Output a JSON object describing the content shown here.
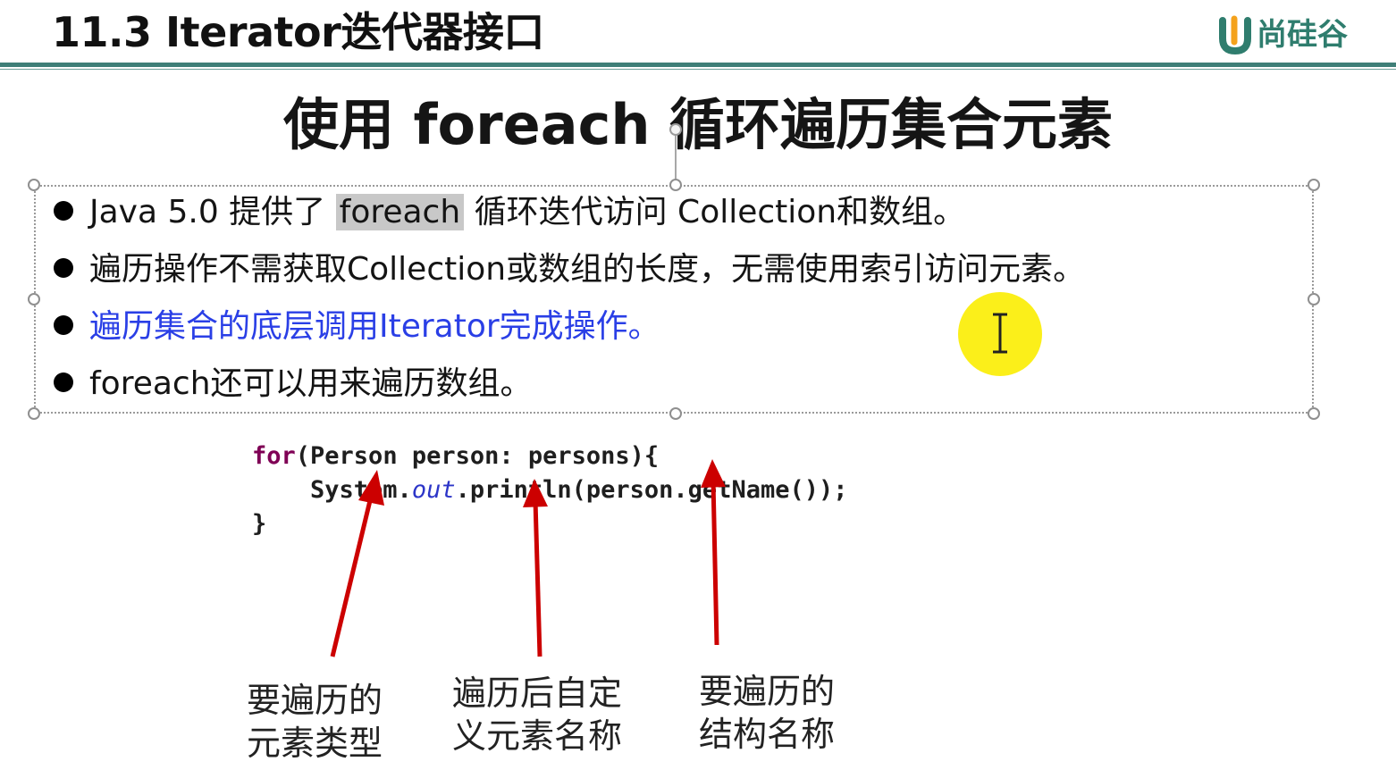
{
  "header": {
    "title": "11.3 Iterator迭代器接口",
    "logo_text": "尚硅谷"
  },
  "slide": {
    "title": "使用 foreach 循环遍历集合元素"
  },
  "bullets": [
    {
      "before": "Java 5.0 提供了 ",
      "highlight": "foreach",
      "after": " 循环迭代访问 Collection和数组。"
    },
    {
      "text": "遍历操作不需获取Collection或数组的长度，无需使用索引访问元素。"
    },
    {
      "text": "遍历集合的底层调用Iterator完成操作。",
      "color": "#2a3fe6"
    },
    {
      "text": "foreach还可以用来遍历数组。"
    }
  ],
  "code": {
    "keyword": "for",
    "line1_rest": "(Person person: persons){",
    "line2_prefix": "    System.",
    "line2_field": "out",
    "line2_suffix": ".println(person.getName());",
    "line3": "}"
  },
  "annotations": {
    "element_type": "要遍历的\n元素类型",
    "custom_name": "遍历后自定\n义元素名称",
    "structure_name": "要遍历的\n结构名称"
  },
  "colors": {
    "header_rule": "#3f7f78",
    "logo": "#2f7d6e",
    "blue_text": "#2a3fe6",
    "arrow": "#cc0000",
    "cursor_highlight": "#fbef1a",
    "keyword": "#7f0055"
  },
  "icons": {
    "logo": "u-logo-icon",
    "cursor": "text-cursor-icon"
  }
}
